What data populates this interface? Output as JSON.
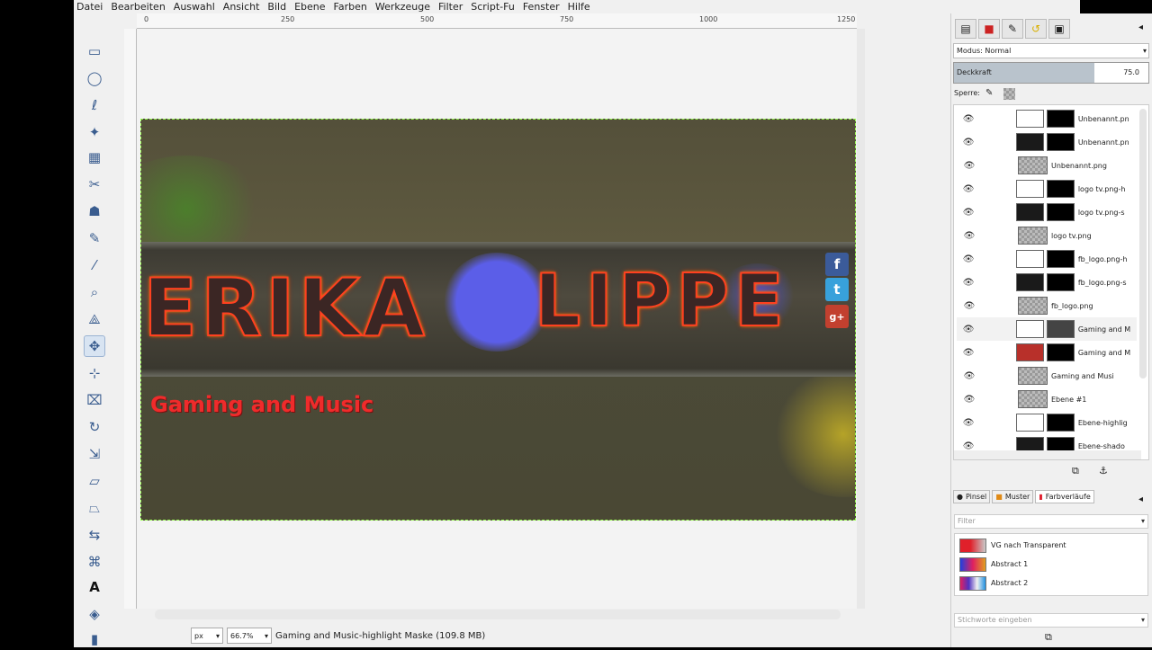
{
  "menu": [
    "Datei",
    "Bearbeiten",
    "Auswahl",
    "Ansicht",
    "Bild",
    "Ebene",
    "Farben",
    "Werkzeuge",
    "Filter",
    "Script-Fu",
    "Fenster",
    "Hilfe"
  ],
  "ruler": {
    "ticks": [
      "0",
      "250",
      "500",
      "750",
      "1000",
      "1250"
    ]
  },
  "image": {
    "title_left": "ERIKA",
    "title_right": "LIPPE",
    "tagline": "Gaming and Music",
    "social": [
      "f",
      "t",
      "g+"
    ]
  },
  "status": {
    "unit": "px",
    "zoom": "66.7%",
    "text": "Gaming and Music-highlight Maske (109.8 MB)"
  },
  "layers_panel": {
    "mode_label": "Modus: Normal",
    "opacity_label": "Deckkraft",
    "opacity_value": "75.0",
    "lock_label": "Sperre:",
    "layers": [
      {
        "name": "Unbenannt.pn",
        "thumb": "white",
        "mask": "black"
      },
      {
        "name": "Unbenannt.pn",
        "thumb": "dark",
        "mask": "black"
      },
      {
        "name": "Unbenannt.png",
        "thumb": "checker",
        "mask": ""
      },
      {
        "name": "logo tv.png-h",
        "thumb": "white",
        "mask": "black"
      },
      {
        "name": "logo tv.png-s",
        "thumb": "dark",
        "mask": "black"
      },
      {
        "name": "logo tv.png",
        "thumb": "checker",
        "mask": ""
      },
      {
        "name": "fb_logo.png-h",
        "thumb": "white",
        "mask": "black"
      },
      {
        "name": "fb_logo.png-s",
        "thumb": "dark",
        "mask": "black"
      },
      {
        "name": "fb_logo.png",
        "thumb": "checker",
        "mask": ""
      },
      {
        "name": "Gaming and M",
        "thumb": "white",
        "mask": "gray"
      },
      {
        "name": "Gaming and M",
        "thumb": "red",
        "mask": "black"
      },
      {
        "name": "Gaming and Music",
        "thumb": "checker",
        "mask": ""
      },
      {
        "name": "Ebene #1",
        "thumb": "checker",
        "mask": ""
      },
      {
        "name": "Ebene-highlig",
        "thumb": "white",
        "mask": "black"
      },
      {
        "name": "Ebene-shado",
        "thumb": "dark",
        "mask": "black"
      }
    ]
  },
  "brushes_panel": {
    "tabs": [
      "Pinsel",
      "Muster",
      "Farbverläufe"
    ],
    "filter_placeholder": "Filter",
    "gradients": [
      {
        "name": "VG nach Transparent"
      },
      {
        "name": "Abstract 1"
      },
      {
        "name": "Abstract 2"
      }
    ],
    "tags_placeholder": "Stichworte eingeben"
  }
}
